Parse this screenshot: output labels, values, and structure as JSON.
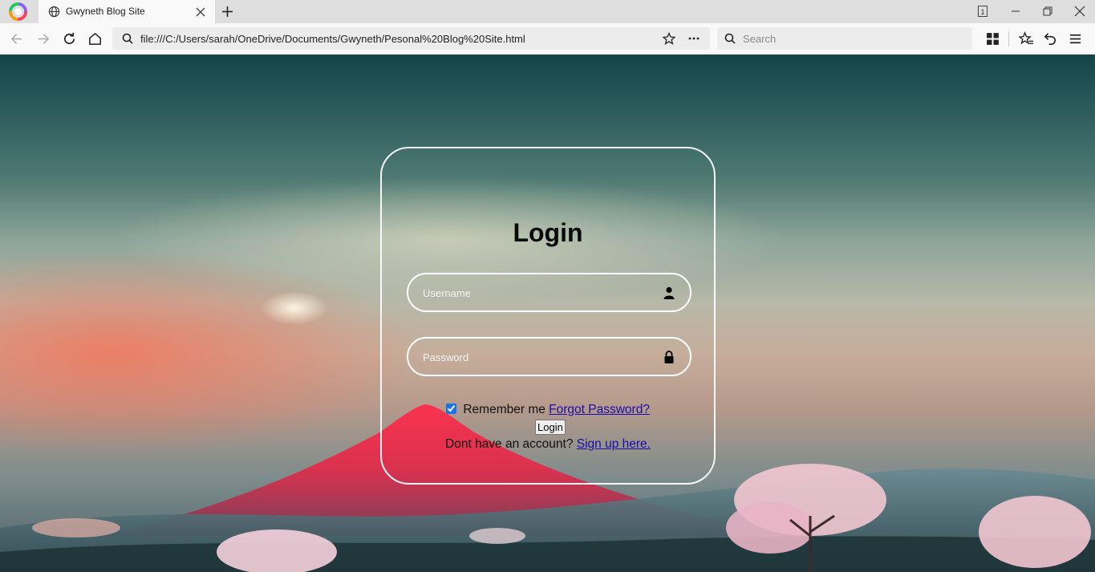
{
  "browser": {
    "tab_title": "Gwyneth Blog Site",
    "url": "file:///C:/Users/sarah/OneDrive/Documents/Gwyneth/Pesonal%20Blog%20Site.html",
    "search_placeholder": "Search",
    "tab_count": "1",
    "icons": [
      "browser-logo-icon",
      "globe-icon",
      "close-icon",
      "plus-icon",
      "tab-count-icon",
      "minimize-icon",
      "restore-icon",
      "window-close-icon",
      "back-icon",
      "forward-icon",
      "reload-icon",
      "home-icon",
      "search-icon",
      "star-icon",
      "more-icon",
      "apps-icon",
      "favorites-icon",
      "undo-icon",
      "menu-icon"
    ]
  },
  "login": {
    "title": "Login",
    "username_placeholder": "Username",
    "password_placeholder": "Password",
    "remember_label": "Remember me",
    "remember_checked": true,
    "forgot_link": "Forgot Password?",
    "login_button": "Login",
    "signup_prompt": "Dont have an account?",
    "signup_link": "Sign up here."
  },
  "colors": {
    "link": "#1a0dab",
    "card_border": "#ffffff",
    "checkbox": "#1a73e8"
  }
}
